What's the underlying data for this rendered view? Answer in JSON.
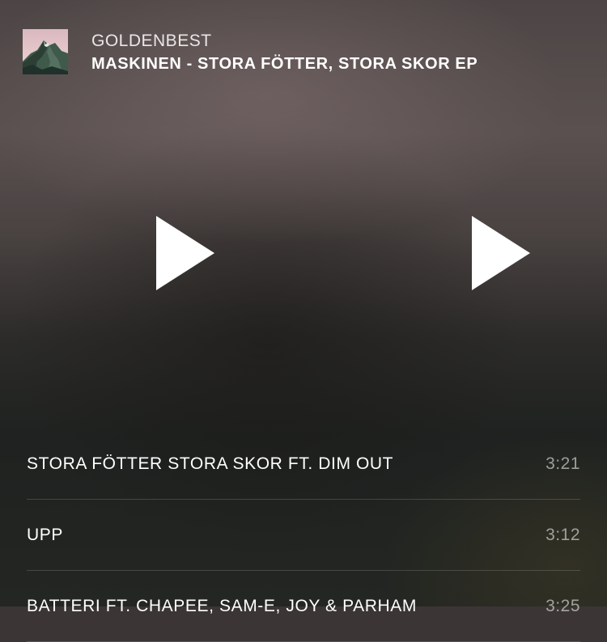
{
  "header": {
    "artist": "GOLDENBEST",
    "album": "MASKINEN - STORA FÖTTER, STORA SKOR EP",
    "artwork_icon": "mountain-artwork-icon"
  },
  "controls": {
    "left_icon": "play-icon",
    "right_icon": "play-icon",
    "icon_color": "#ffffff"
  },
  "tracks": [
    {
      "title": "STORA FÖTTER STORA SKOR FT. DIM OUT",
      "duration": "3:21"
    },
    {
      "title": "UPP",
      "duration": "3:12"
    },
    {
      "title": "BATTERI FT. CHAPEE, SAM-E, JOY & PARHAM",
      "duration": "3:25"
    }
  ]
}
